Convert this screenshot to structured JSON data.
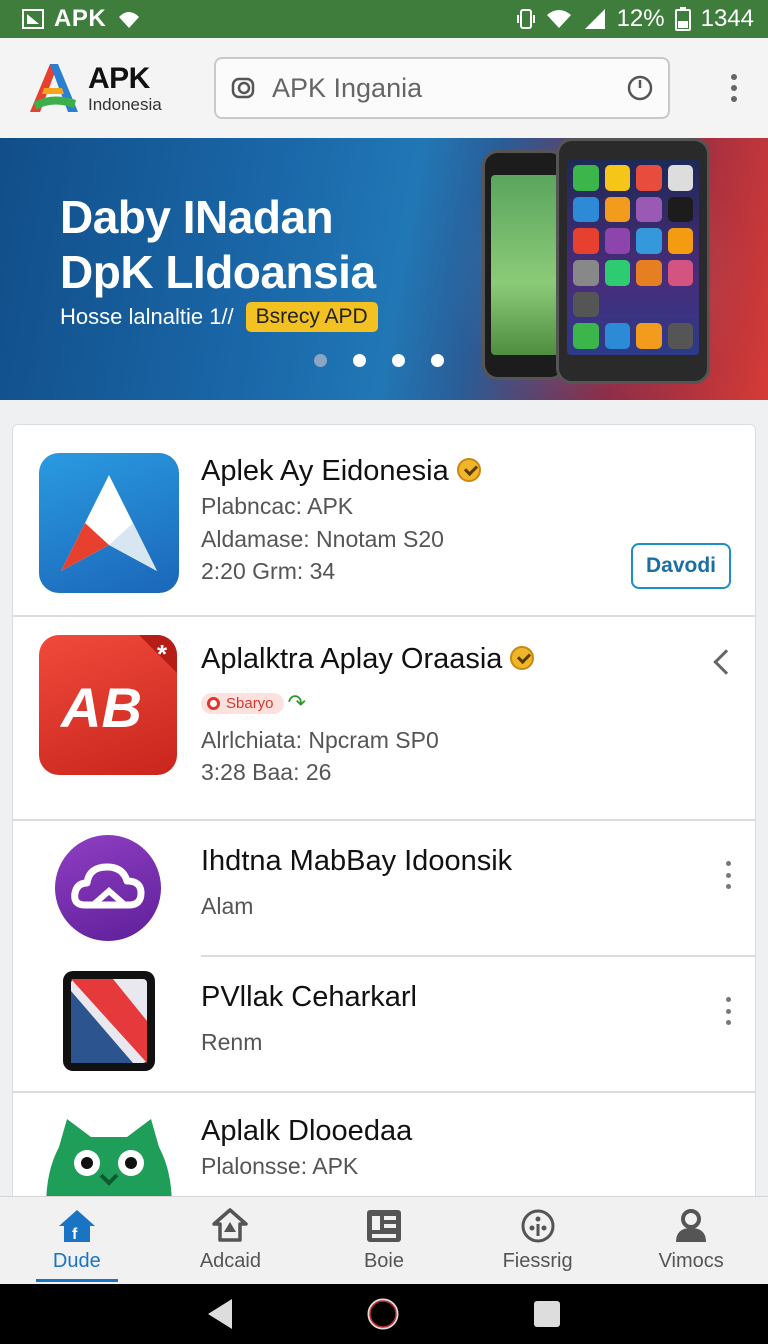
{
  "status_bar": {
    "app_label": "APK",
    "battery": "12%",
    "time": "1344"
  },
  "header": {
    "logo_title": "APK",
    "logo_subtitle": "Indonesia",
    "search_placeholder": "APK Ingania"
  },
  "banner": {
    "title_line1": "Daby INadan",
    "title_line2": "DpK LIdoansia",
    "subtitle": "Hosse lalnaltie 1//",
    "badge": "Bsrecy APD",
    "dots_total": 4,
    "active_dot": 1
  },
  "apps": [
    {
      "name": "Aplek Ay Eidonesia",
      "verified": true,
      "meta1": "Plabncac: APK",
      "meta2": "Aldamase: Nnotam S20",
      "meta3": "2:20 Grm: 34",
      "action": "Davodi"
    },
    {
      "name": "Aplalktra Aplay Oraasia",
      "verified": true,
      "pill": "Sbaryo",
      "meta2": "Alrlchiata: Npcram SP0",
      "meta3": "3:28 Baa: 26"
    },
    {
      "name": "Ihdtna MabBay Idoonsik",
      "meta1": "Alam"
    },
    {
      "name": "PVllak Ceharkarl",
      "meta1": "Renm"
    },
    {
      "name": "Aplalk Dlooedaa",
      "meta1": "Plalonsse: APK"
    }
  ],
  "bottom_nav": [
    {
      "label": "Dude",
      "icon": "home-icon",
      "active": true
    },
    {
      "label": "Adcaid",
      "icon": "house-star-icon",
      "active": false
    },
    {
      "label": "Boie",
      "icon": "document-icon",
      "active": false
    },
    {
      "label": "Fiessrig",
      "icon": "settings-circle-icon",
      "active": false
    },
    {
      "label": "Vimocs",
      "icon": "person-icon",
      "active": false
    }
  ],
  "colors": {
    "status_bar": "#3f7d3d",
    "accent": "#1a74c4",
    "badge": "#f3c222"
  }
}
